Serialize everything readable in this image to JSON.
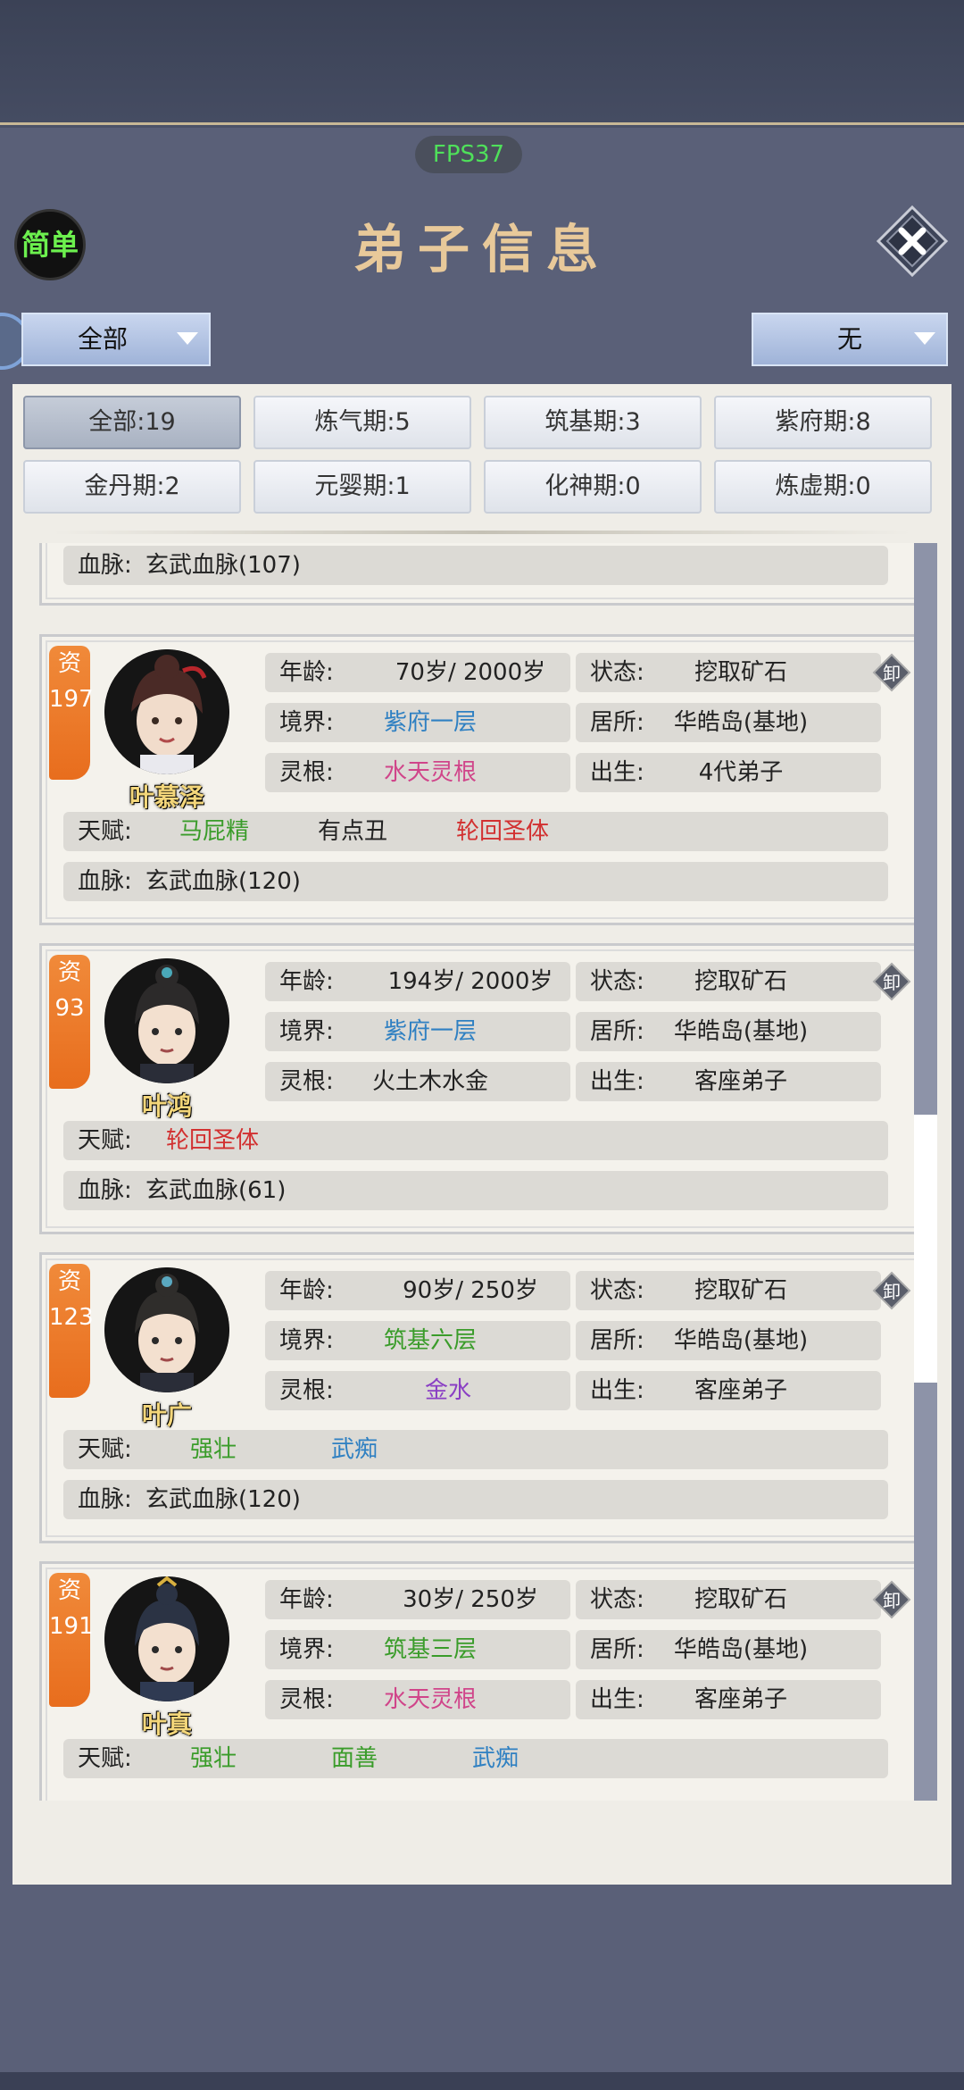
{
  "fps": "FPS37",
  "mode_button": "简单",
  "title": "弟子信息",
  "filter_left": "全部",
  "filter_right": "无",
  "tabs": [
    {
      "label": "全部:19",
      "active": true
    },
    {
      "label": "炼气期:5"
    },
    {
      "label": "筑基期:3"
    },
    {
      "label": "紫府期:8"
    },
    {
      "label": "金丹期:2"
    },
    {
      "label": "元婴期:1"
    },
    {
      "label": "化神期:0"
    },
    {
      "label": "炼虚期:0"
    }
  ],
  "labels": {
    "age": "年龄:",
    "state": "状态:",
    "realm": "境界:",
    "residence": "居所:",
    "root": "灵根:",
    "birth": "出生:",
    "talent": "天赋:",
    "blood": "血脉:",
    "unload": "卸",
    "zi": "资"
  },
  "partial_top": {
    "blood": "玄武血脉(107)"
  },
  "disciples": [
    {
      "name": "叶慕泽",
      "aptitude": "197",
      "age": "70岁/ 2000岁",
      "state": "挖取矿石",
      "realm": "紫府一层",
      "realm_color": "#2f80c2",
      "residence": "华皓岛(基地)",
      "root": "水天灵根",
      "root_color": "#d0458a",
      "birth": "4代弟子",
      "talents": [
        {
          "text": "马屁精",
          "color": "#3a9c2a"
        },
        {
          "text": "有点丑",
          "color": "#222222"
        },
        {
          "text": "轮回圣体",
          "color": "#d23030"
        }
      ],
      "blood": "玄武血脉(120)"
    },
    {
      "name": "叶鸿",
      "aptitude": "93",
      "age": "194岁/ 2000岁",
      "state": "挖取矿石",
      "realm": "紫府一层",
      "realm_color": "#2f80c2",
      "residence": "华皓岛(基地)",
      "root": "火土木水金",
      "root_color": "#222222",
      "birth": "客座弟子",
      "talents": [
        {
          "text": "轮回圣体",
          "color": "#d23030"
        }
      ],
      "blood": "玄武血脉(61)"
    },
    {
      "name": "叶广",
      "aptitude": "123",
      "age": "90岁/ 250岁",
      "state": "挖取矿石",
      "realm": "筑基六层",
      "realm_color": "#3a9c2a",
      "residence": "华皓岛(基地)",
      "root": "金水",
      "root_color": "#8a3fc4",
      "birth": "客座弟子",
      "talents": [
        {
          "text": "强壮",
          "color": "#3a9c2a"
        },
        {
          "text": "武痴",
          "color": "#2f80c2"
        }
      ],
      "blood": "玄武血脉(120)"
    },
    {
      "name": "叶真",
      "aptitude": "191",
      "age": "30岁/ 250岁",
      "state": "挖取矿石",
      "realm": "筑基三层",
      "realm_color": "#3a9c2a",
      "residence": "华皓岛(基地)",
      "root": "水天灵根",
      "root_color": "#d0458a",
      "birth": "客座弟子",
      "talents": [
        {
          "text": "强壮",
          "color": "#3a9c2a"
        },
        {
          "text": "面善",
          "color": "#3a9c2a"
        },
        {
          "text": "武痴",
          "color": "#2f80c2"
        }
      ]
    }
  ]
}
